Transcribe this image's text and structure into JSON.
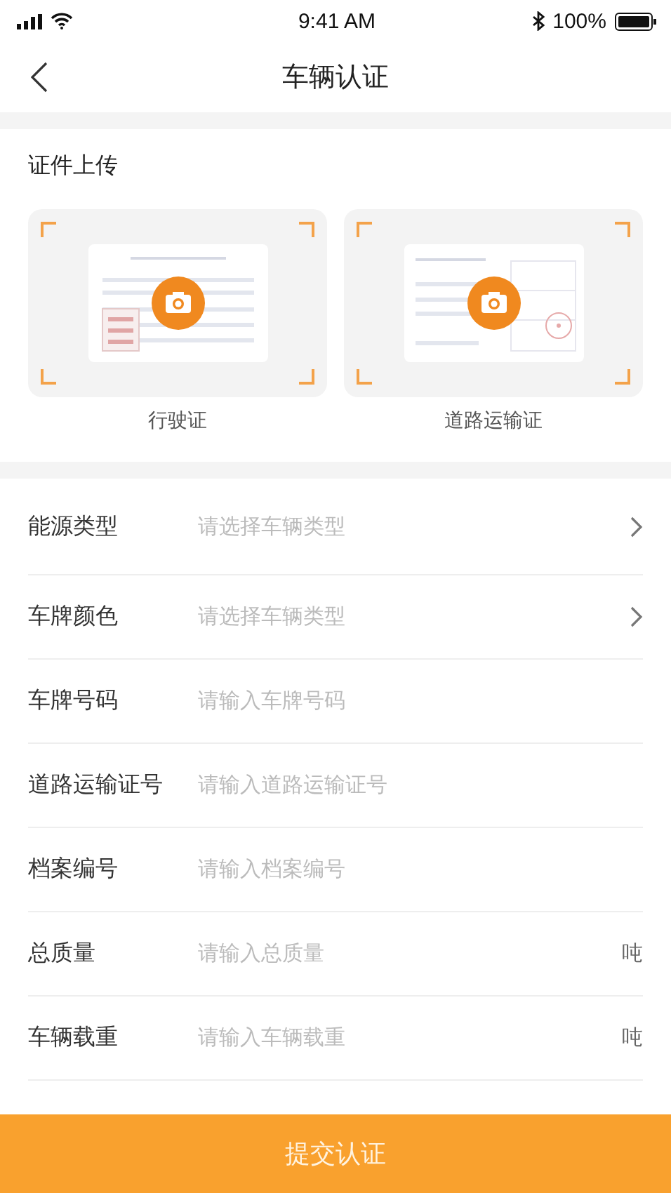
{
  "status_bar": {
    "time": "9:41 AM",
    "battery": "100%"
  },
  "nav": {
    "title": "车辆认证"
  },
  "upload": {
    "title": "证件上传",
    "cards": [
      {
        "label": "行驶证",
        "kind": "license"
      },
      {
        "label": "道路运输证",
        "kind": "permit"
      }
    ]
  },
  "fields": [
    {
      "kind": "select",
      "label": "能源类型",
      "placeholder": "请选择车辆类型"
    },
    {
      "kind": "select",
      "label": "车牌颜色",
      "placeholder": "请选择车辆类型"
    },
    {
      "kind": "input",
      "label": "车牌号码",
      "placeholder": "请输入车牌号码"
    },
    {
      "kind": "input",
      "label": "道路运输证号",
      "placeholder": "请输入道路运输证号"
    },
    {
      "kind": "input",
      "label": "档案编号",
      "placeholder": "请输入档案编号"
    },
    {
      "kind": "input",
      "label": "总质量",
      "placeholder": "请输入总质量",
      "unit": "吨"
    },
    {
      "kind": "input",
      "label": "车辆载重",
      "placeholder": "请输入车辆载重",
      "unit": "吨"
    }
  ],
  "submit_button": "提交认证"
}
